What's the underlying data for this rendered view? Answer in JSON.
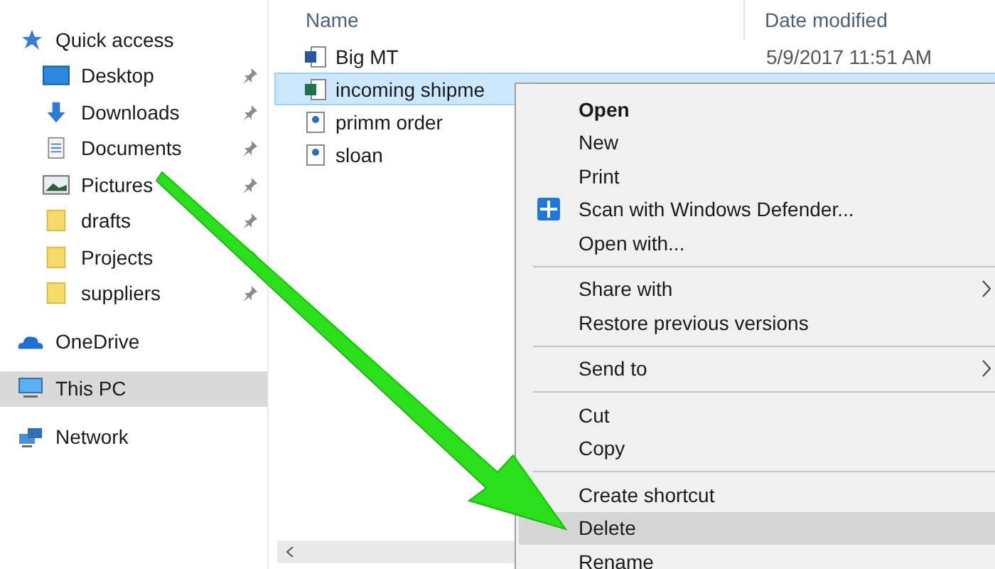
{
  "sidebar": {
    "items": [
      {
        "label": "Quick access",
        "kind": "star",
        "selected": false,
        "children": [
          {
            "label": "Desktop",
            "kind": "desktop",
            "pinned": true
          },
          {
            "label": "Downloads",
            "kind": "download",
            "pinned": true
          },
          {
            "label": "Documents",
            "kind": "document",
            "pinned": true
          },
          {
            "label": "Pictures",
            "kind": "pictures",
            "pinned": true
          },
          {
            "label": "drafts",
            "kind": "folder",
            "pinned": true
          },
          {
            "label": "Projects",
            "kind": "folder",
            "pinned": true
          },
          {
            "label": "suppliers",
            "kind": "folder",
            "pinned": true
          }
        ]
      },
      {
        "label": "OneDrive",
        "kind": "cloud",
        "selected": false
      },
      {
        "label": "This PC",
        "kind": "pc",
        "selected": true
      },
      {
        "label": "Network",
        "kind": "network",
        "selected": false
      }
    ]
  },
  "file_list": {
    "columns": [
      "Name",
      "Date modified"
    ],
    "rows": [
      {
        "name": "Big MT",
        "kind": "word",
        "date": "5/9/2017 11:51 AM",
        "selected": false
      },
      {
        "name": "incoming shipme",
        "kind": "excel",
        "selected": true
      },
      {
        "name": "primm order",
        "kind": "pdf",
        "selected": false
      },
      {
        "name": "sloan",
        "kind": "pdf",
        "selected": false
      }
    ]
  },
  "context_menu": {
    "items": [
      {
        "kind": "item",
        "label": "Open",
        "bold": true,
        "selected": false
      },
      {
        "kind": "item",
        "label": "New",
        "selected": false
      },
      {
        "kind": "item",
        "label": "Print",
        "selected": false
      },
      {
        "kind": "defender",
        "label": "Scan with Windows Defender...",
        "selected": false
      },
      {
        "kind": "item",
        "label": "Open with...",
        "selected": false
      },
      {
        "kind": "separator"
      },
      {
        "kind": "item",
        "label": "Share with",
        "submenu": true,
        "selected": false
      },
      {
        "kind": "item",
        "label": "Restore previous versions",
        "selected": false
      },
      {
        "kind": "separator"
      },
      {
        "kind": "item",
        "label": "Send to",
        "submenu": true,
        "selected": false
      },
      {
        "kind": "separator"
      },
      {
        "kind": "item",
        "label": "Cut",
        "selected": false
      },
      {
        "kind": "item",
        "label": "Copy",
        "selected": false
      },
      {
        "kind": "separator"
      },
      {
        "kind": "item",
        "label": "Create shortcut",
        "selected": false
      },
      {
        "kind": "item",
        "label": "Delete",
        "selected": true
      },
      {
        "kind": "item",
        "label": "Rename",
        "selected": false
      }
    ]
  }
}
